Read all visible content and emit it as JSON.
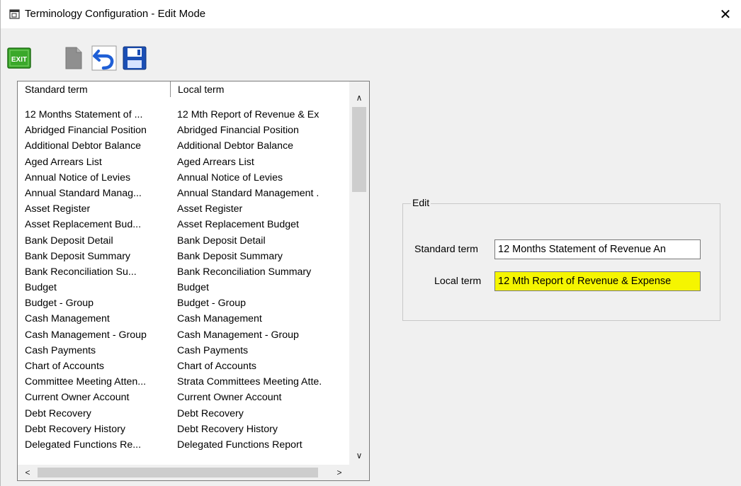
{
  "window": {
    "title": "Terminology Configuration - Edit Mode",
    "close_glyph": "✕"
  },
  "toolbar": {
    "exit_label": "EXIT",
    "buttons": [
      "exit-icon",
      "new-document-icon",
      "undo-icon",
      "save-icon"
    ]
  },
  "list": {
    "headers": {
      "standard": "Standard term",
      "local": "Local term"
    },
    "rows": [
      {
        "standard": "12 Months Statement of ...",
        "local": "12 Mth Report of Revenue & Ex"
      },
      {
        "standard": "Abridged Financial Position",
        "local": "Abridged Financial Position"
      },
      {
        "standard": "Additional Debtor Balance",
        "local": "Additional Debtor Balance"
      },
      {
        "standard": "Aged Arrears List",
        "local": "Aged Arrears List"
      },
      {
        "standard": "Annual Notice of Levies",
        "local": "Annual Notice of Levies"
      },
      {
        "standard": "Annual Standard Manag...",
        "local": "Annual Standard Management ."
      },
      {
        "standard": "Asset Register",
        "local": "Asset Register"
      },
      {
        "standard": "Asset Replacement Bud...",
        "local": "Asset Replacement Budget"
      },
      {
        "standard": "Bank Deposit Detail",
        "local": "Bank Deposit Detail"
      },
      {
        "standard": "Bank Deposit Summary",
        "local": "Bank Deposit Summary"
      },
      {
        "standard": "Bank Reconciliation Su...",
        "local": "Bank Reconciliation Summary"
      },
      {
        "standard": "Budget",
        "local": "Budget"
      },
      {
        "standard": "Budget - Group",
        "local": "Budget - Group"
      },
      {
        "standard": "Cash Management",
        "local": "Cash Management"
      },
      {
        "standard": "Cash Management - Group",
        "local": "Cash Management - Group"
      },
      {
        "standard": "Cash Payments",
        "local": "Cash Payments"
      },
      {
        "standard": "Chart of Accounts",
        "local": "Chart of Accounts"
      },
      {
        "standard": "Committee Meeting Atten...",
        "local": "Strata Committees Meeting Atte."
      },
      {
        "standard": "Current Owner Account",
        "local": "Current Owner Account"
      },
      {
        "standard": "Debt Recovery",
        "local": "Debt Recovery"
      },
      {
        "standard": "Debt Recovery History",
        "local": "Debt Recovery History"
      },
      {
        "standard": "Delegated Functions Re...",
        "local": "Delegated Functions Report"
      }
    ]
  },
  "edit": {
    "group_label": "Edit",
    "standard_label": "Standard term",
    "local_label": "Local term",
    "standard_value": "12 Months Statement of Revenue An",
    "local_value": "12 Mth Report of Revenue & Expense"
  },
  "colors": {
    "highlight": "#f5f500",
    "exit_green": "#3aa82a",
    "undo_blue": "#1f5fd6",
    "save_blue": "#1b4fb5"
  }
}
